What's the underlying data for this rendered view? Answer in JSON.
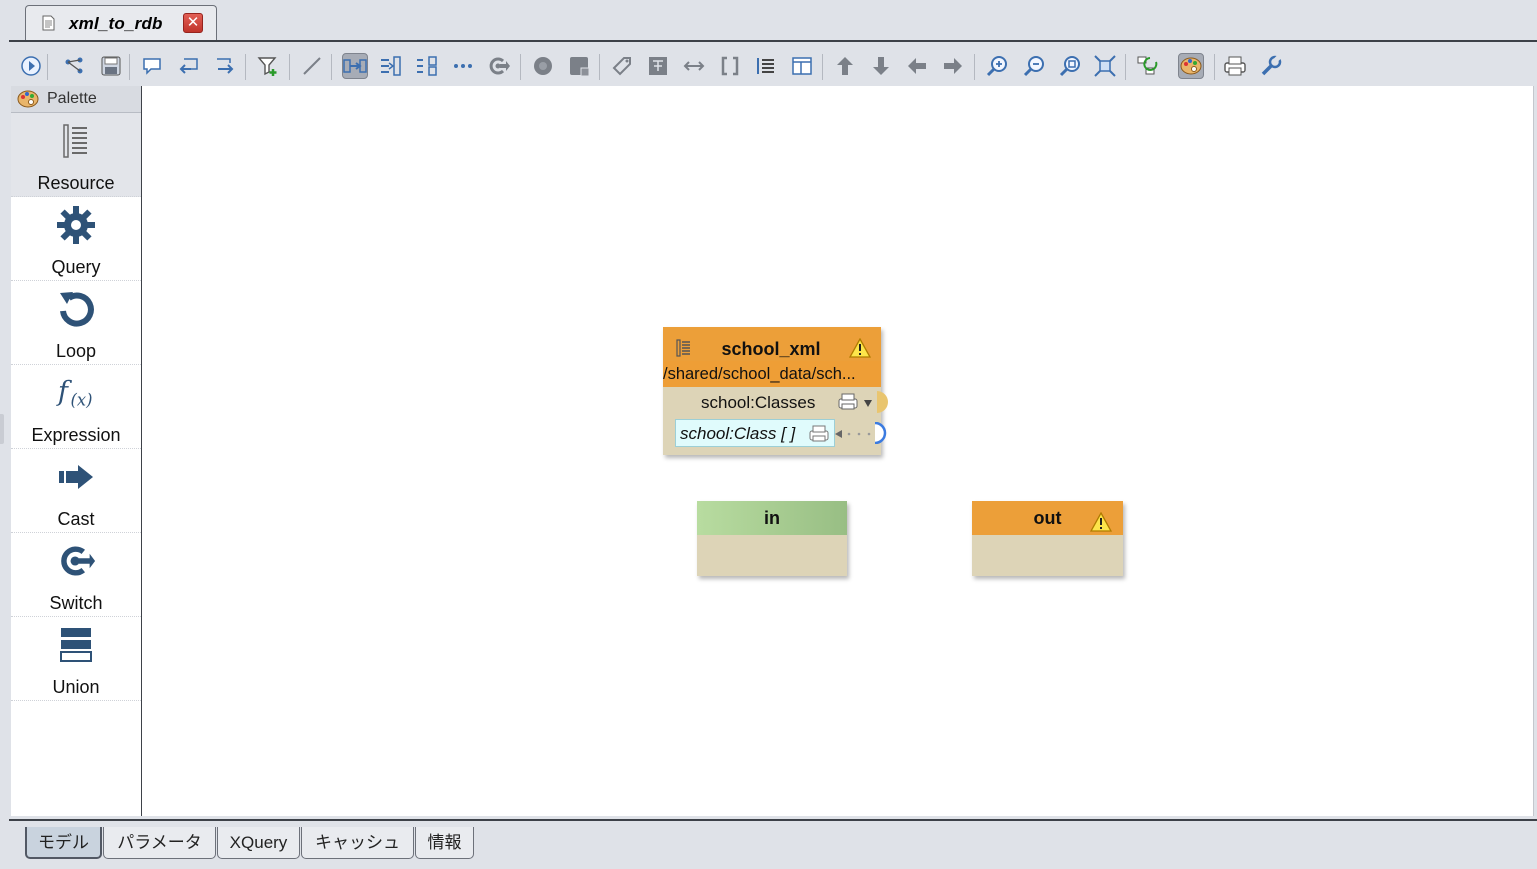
{
  "editor_tab": {
    "title": "xml_to_rdb",
    "icon": "document-icon",
    "close_icon": "close-icon",
    "close_label": "✕"
  },
  "toolbar": {
    "buttons": [
      {
        "name": "run-icon",
        "active": false
      },
      {
        "name": "graph-layout-icon",
        "active": false
      },
      {
        "name": "save-icon",
        "active": false
      },
      {
        "name": "comment-icon",
        "active": false
      },
      {
        "name": "comment-back-icon",
        "active": false
      },
      {
        "name": "comment-forward-icon",
        "active": false
      },
      {
        "name": "add-filter-icon",
        "active": false
      },
      {
        "name": "line-icon",
        "active": false
      },
      {
        "name": "link-mode-icon",
        "active": true
      },
      {
        "name": "align-columns-icon",
        "active": false
      },
      {
        "name": "align-grid-icon",
        "active": false
      },
      {
        "name": "more-icon",
        "active": false
      },
      {
        "name": "switch-icon",
        "active": false
      },
      {
        "name": "circle-icon",
        "active": false
      },
      {
        "name": "table-icon",
        "active": false
      },
      {
        "name": "tag-icon",
        "active": false
      },
      {
        "name": "tree-icon",
        "active": false
      },
      {
        "name": "expand-horizontal-icon",
        "active": false
      },
      {
        "name": "brackets-icon",
        "active": false
      },
      {
        "name": "list-icon",
        "active": false
      },
      {
        "name": "columns-icon",
        "active": false
      },
      {
        "name": "move-up-icon",
        "active": false
      },
      {
        "name": "move-down-icon",
        "active": false
      },
      {
        "name": "move-left-icon",
        "active": false
      },
      {
        "name": "move-right-icon",
        "active": false
      },
      {
        "name": "zoom-in-icon",
        "active": false
      },
      {
        "name": "zoom-out-icon",
        "active": false
      },
      {
        "name": "zoom-reset-icon",
        "active": false
      },
      {
        "name": "fit-to-window-icon",
        "active": false
      },
      {
        "name": "refresh-layout-icon",
        "active": false
      },
      {
        "name": "palette-toggle-icon",
        "active": true
      },
      {
        "name": "print-icon",
        "active": false
      },
      {
        "name": "settings-wrench-icon",
        "active": false
      }
    ]
  },
  "palette": {
    "title": "Palette",
    "icon": "palette-icon",
    "items": [
      {
        "label": "Resource",
        "icon": "resource-icon"
      },
      {
        "label": "Query",
        "icon": "gear-icon"
      },
      {
        "label": "Loop",
        "icon": "loop-icon"
      },
      {
        "label": "Expression",
        "icon": "function-icon"
      },
      {
        "label": "Cast",
        "icon": "arrow-right-icon"
      },
      {
        "label": "Switch",
        "icon": "switch-icon"
      },
      {
        "label": "Union",
        "icon": "union-icon"
      }
    ]
  },
  "canvas": {
    "resource_node": {
      "title": "school_xml",
      "icon": "resource-icon",
      "warning_icon": "warning-icon",
      "path": "/shared/school_data/sch...",
      "port_label": "school:Classes",
      "sub_port_label": "school:Class [ ]",
      "header_color": "#ec9f39",
      "body_color": "#ddd4b7"
    },
    "in_node": {
      "title": "in",
      "header_color": "#a9cf91"
    },
    "out_node": {
      "title": "out",
      "warning_icon": "warning-icon",
      "header_color": "#ec9f39"
    }
  },
  "bottom_tabs": [
    {
      "label": "モデル",
      "active": true
    },
    {
      "label": "パラメータ",
      "active": false
    },
    {
      "label": "XQuery",
      "active": false
    },
    {
      "label": "キャッシュ",
      "active": false
    },
    {
      "label": "情報",
      "active": false
    }
  ]
}
